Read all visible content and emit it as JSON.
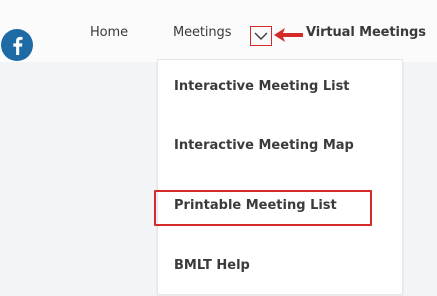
{
  "nav": {
    "home_label": "Home",
    "meetings_label": "Meetings",
    "virtual_label": "Virtual Meetings"
  },
  "dropdown": {
    "items": [
      {
        "label": "Interactive Meeting List"
      },
      {
        "label": "Interactive Meeting Map"
      },
      {
        "label": "Printable Meeting List",
        "highlighted": true
      },
      {
        "label": "BMLT Help"
      }
    ]
  },
  "colors": {
    "annotation_red": "#d42a2a",
    "facebook_blue": "#1d6aa5",
    "background": "#f2f4f7",
    "menu_bg": "#ffffff"
  },
  "icons": {
    "social": "facebook-icon",
    "dropdown_toggle": "chevron-down-icon",
    "annotation": "red-arrow-icon"
  }
}
